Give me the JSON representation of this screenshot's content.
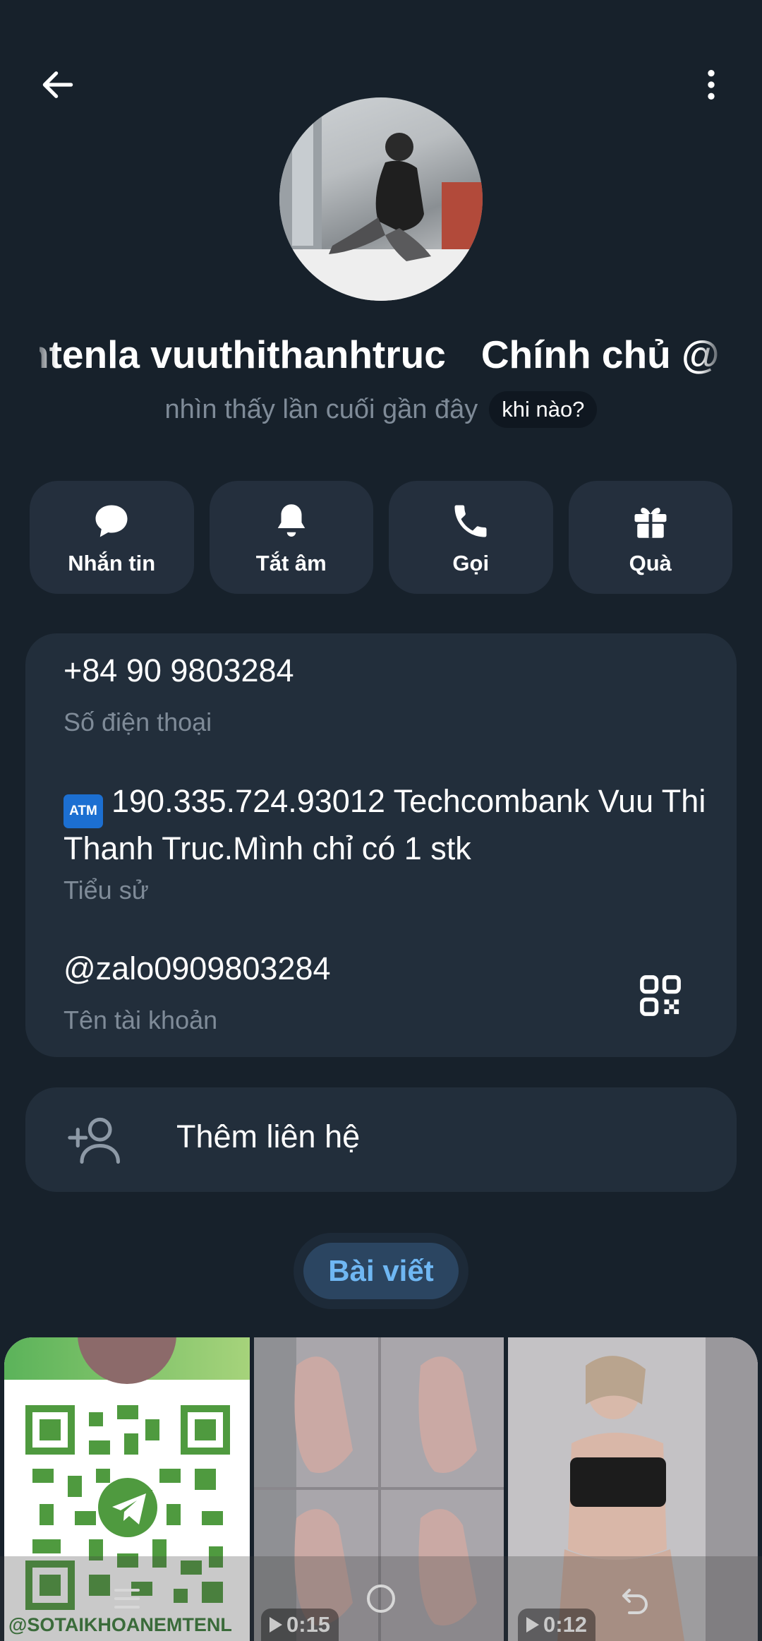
{
  "header": {
    "back_icon": "arrow-left-icon",
    "more_icon": "more-vertical-icon"
  },
  "profile": {
    "name_left": "ntenla vuuthithanhtruc",
    "name_right": "Chính chủ @",
    "status": "nhìn thấy lần cuối gần đây",
    "when_badge": "khi nào?"
  },
  "actions": [
    {
      "label": "Nhắn tin",
      "icon": "message-bubble-icon"
    },
    {
      "label": "Tắt âm",
      "icon": "bell-icon"
    },
    {
      "label": "Gọi",
      "icon": "phone-icon"
    },
    {
      "label": "Quà",
      "icon": "gift-icon"
    }
  ],
  "info": {
    "phone": "+84 90 9803284",
    "phone_label": "Số điện thoại",
    "atm_badge": "ATM",
    "bio": "190.335.724.93012 Techcombank Vuu Thi Thanh Truc.Mình chỉ có 1 stk",
    "bio_label": "Tiểu sử",
    "username": "@zalo0909803284",
    "username_label": "Tên tài khoản"
  },
  "add_contact": {
    "label": "Thêm liên hệ",
    "icon": "add-person-icon"
  },
  "tabs": [
    {
      "label": "Bài viết",
      "active": true
    }
  ],
  "media": [
    {
      "type": "image",
      "caption": "@SOTAIKHOANEMTENL"
    },
    {
      "type": "video",
      "duration": "0:15"
    },
    {
      "type": "video",
      "duration": "0:12"
    }
  ],
  "colors": {
    "background": "#17212b",
    "card": "#222e3b",
    "button": "#242f3d",
    "muted_text": "#7f8b98",
    "accent": "#6fb7f3"
  }
}
